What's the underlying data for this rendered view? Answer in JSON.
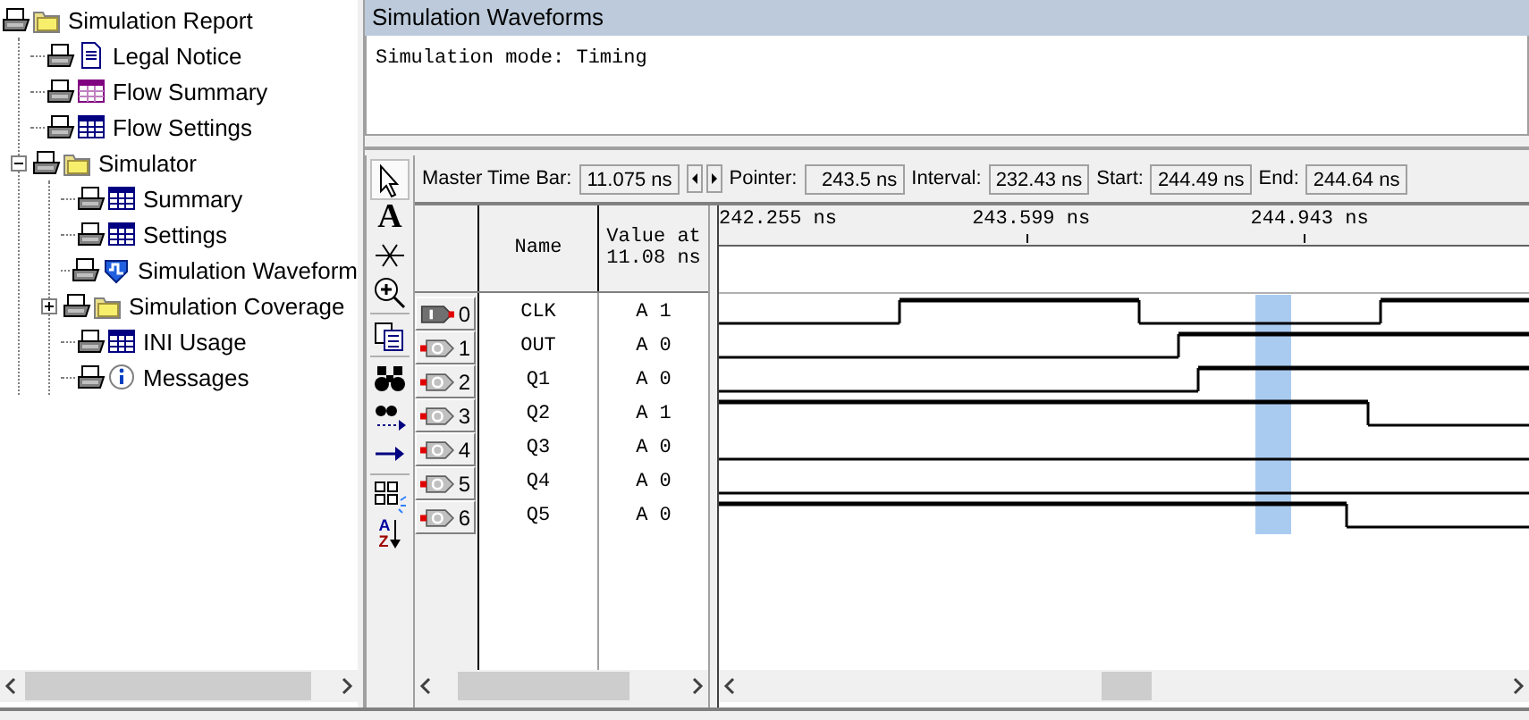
{
  "report_tree": [
    {
      "label": "Simulation Report",
      "kind": "folder",
      "children": [
        {
          "label": "Legal Notice",
          "kind": "document"
        },
        {
          "label": "Flow Summary",
          "kind": "summary-table"
        },
        {
          "label": "Flow Settings",
          "kind": "table"
        },
        {
          "label": "Simulator",
          "kind": "folder",
          "expanded": true,
          "children": [
            {
              "label": "Summary",
              "kind": "table"
            },
            {
              "label": "Settings",
              "kind": "table"
            },
            {
              "label": "Simulation Waveform",
              "kind": "waveform"
            },
            {
              "label": "Simulation Coverage",
              "kind": "folder",
              "expanded": false
            },
            {
              "label": "INI Usage",
              "kind": "table"
            },
            {
              "label": "Messages",
              "kind": "info"
            }
          ]
        }
      ]
    }
  ],
  "panel": {
    "title": "Simulation Waveforms",
    "message": "Simulation mode: Timing"
  },
  "tools": [
    {
      "kind": "pointer",
      "selected": true
    },
    {
      "kind": "text",
      "glyph": "A",
      "selected": false
    },
    {
      "kind": "snap",
      "selected": false
    },
    {
      "kind": "zoom",
      "selected": false
    },
    {
      "kind": "copy",
      "selected": false
    },
    {
      "kind": "find",
      "selected": false
    },
    {
      "kind": "find-next",
      "selected": false
    },
    {
      "kind": "goto",
      "selected": false
    },
    {
      "kind": "group",
      "selected": false
    },
    {
      "kind": "sort",
      "letters": [
        "A",
        "Z"
      ],
      "selected": false
    }
  ],
  "time_bar": {
    "master_label": "Master Time Bar:",
    "master_value": "11.075 ns",
    "pointer_label": "Pointer:",
    "pointer_value": "243.5 ns",
    "interval_label": "Interval:",
    "interval_value": "232.43 ns",
    "start_label": "Start:",
    "start_value": "244.49 ns",
    "end_label": "End:",
    "end_value": "244.64 ns"
  },
  "columns": {
    "name": "Name",
    "value": "Value at 11.08 ns"
  },
  "ruler": [
    "242.255 ns",
    "243.599 ns",
    "244.943 ns"
  ],
  "signals": [
    {
      "index": "0",
      "kind": "input",
      "name": "CLK",
      "value": "A 1"
    },
    {
      "index": "1",
      "kind": "output",
      "name": "OUT",
      "value": "A 0"
    },
    {
      "index": "2",
      "kind": "output",
      "name": "Q1",
      "value": "A 0"
    },
    {
      "index": "3",
      "kind": "output",
      "name": "Q2",
      "value": "A 1"
    },
    {
      "index": "4",
      "kind": "output",
      "name": "Q3",
      "value": "A 0"
    },
    {
      "index": "5",
      "kind": "output",
      "name": "Q4",
      "value": "A 0"
    },
    {
      "index": "6",
      "kind": "output",
      "name": "Q5",
      "value": "A 0"
    }
  ]
}
